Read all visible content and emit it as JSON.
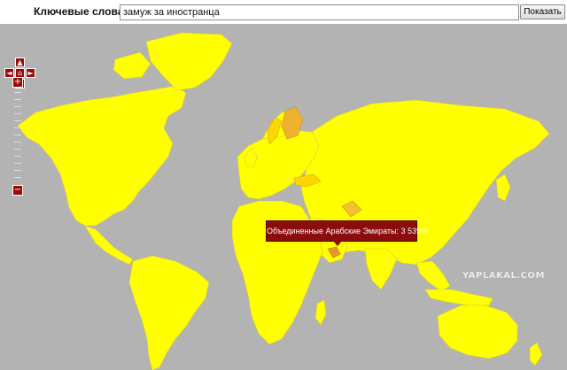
{
  "search": {
    "label": "Ключевые слова:",
    "value": "замуж за иностранца",
    "button": "Показать"
  },
  "map": {
    "tooltip": "Объединенные Арабские Эмираты: 3 539%",
    "zoom_in": "+",
    "zoom_out": "−",
    "pan_up": "▲",
    "pan_down": "▼",
    "pan_left": "◄",
    "pan_right": "►",
    "pan_home": "⌂",
    "watermark": "YAPLAKAL.COM",
    "colors": {
      "ocean": "#b3b3b3",
      "low": "#ffff00",
      "medium": "#ffd700",
      "high": "#f0b030",
      "highest": "#e89a28",
      "controls": "#9b0a0a"
    }
  }
}
